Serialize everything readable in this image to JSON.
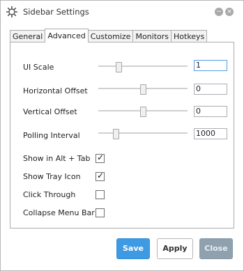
{
  "window": {
    "title": "Sidebar Settings",
    "icon": "gear-icon"
  },
  "tabs": [
    {
      "label": "General",
      "active": false
    },
    {
      "label": "Advanced",
      "active": true
    },
    {
      "label": "Customize",
      "active": false
    },
    {
      "label": "Monitors",
      "active": false
    },
    {
      "label": "Hotkeys",
      "active": false
    }
  ],
  "settings": {
    "ui_scale": {
      "label": "UI Scale",
      "value": "1",
      "slider_fraction": 0.21
    },
    "horizontal_offset": {
      "label": "Horizontal Offset",
      "value": "0",
      "slider_fraction": 0.5
    },
    "vertical_offset": {
      "label": "Vertical Offset",
      "value": "0",
      "slider_fraction": 0.5
    },
    "polling_interval": {
      "label": "Polling Interval",
      "value": "1000",
      "slider_fraction": 0.18
    }
  },
  "options": {
    "show_alt_tab": {
      "label": "Show in Alt + Tab",
      "checked": true
    },
    "show_tray_icon": {
      "label": "Show Tray Icon",
      "checked": true
    },
    "click_through": {
      "label": "Click Through",
      "checked": false
    },
    "collapse_menu_bar": {
      "label": "Collapse Menu Bar",
      "checked": false
    }
  },
  "buttons": {
    "save": "Save",
    "apply": "Apply",
    "close": "Close"
  },
  "colors": {
    "accent": "#3d9ae3",
    "close_button": "#8fa1ae",
    "focus_border": "#569de5"
  }
}
